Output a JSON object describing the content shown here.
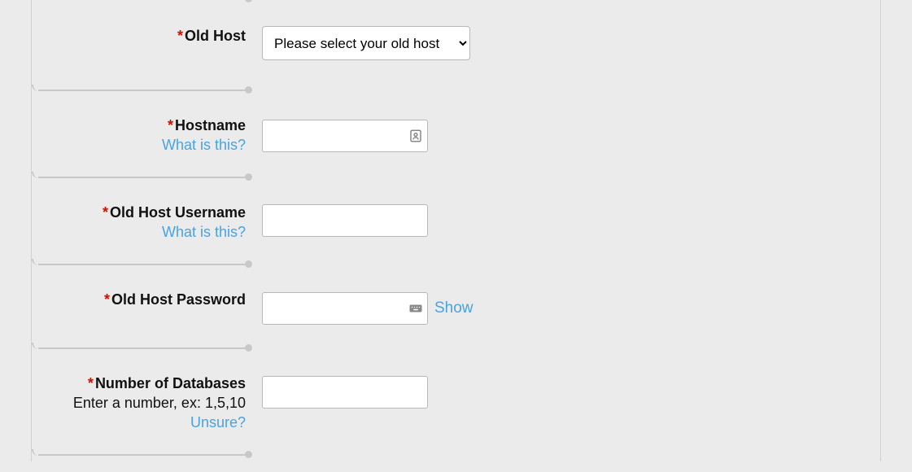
{
  "fields": {
    "oldHost": {
      "label": "Old Host",
      "placeholder": "Please select your old host"
    },
    "hostname": {
      "label": "Hostname",
      "help": "What is this?"
    },
    "oldHostUsername": {
      "label": "Old Host Username",
      "help": "What is this?"
    },
    "oldHostPassword": {
      "label": "Old Host Password",
      "showLabel": "Show"
    },
    "numDatabases": {
      "label": "Number of Databases",
      "sublabel": "Enter a number, ex: 1,5,10",
      "help": "Unsure?"
    }
  },
  "requiredMark": "*"
}
